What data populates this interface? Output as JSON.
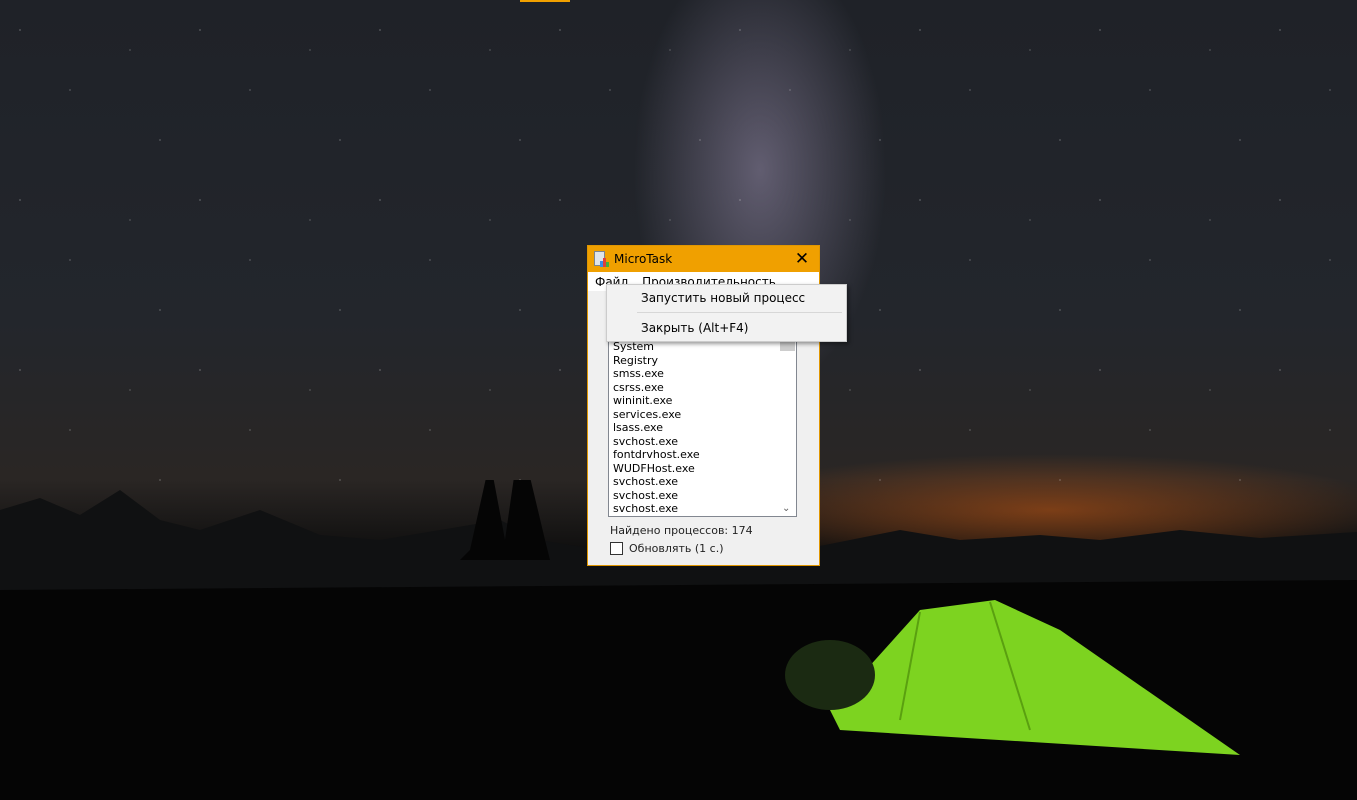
{
  "colors": {
    "accent": "#f0a000",
    "window_bg": "#f0f0f0"
  },
  "window": {
    "title": "MicroTask",
    "close_icon": "close-icon",
    "app_icon": "task-manager-icon"
  },
  "menu": {
    "file": "Файл",
    "performance": "Производительность"
  },
  "context_menu": {
    "items": [
      "Запустить новый процесс",
      "Закрыть (Alt+F4)"
    ]
  },
  "processes": [
    "System",
    "Registry",
    "smss.exe",
    "csrss.exe",
    "wininit.exe",
    "services.exe",
    "lsass.exe",
    "svchost.exe",
    "fontdrvhost.exe",
    "WUDFHost.exe",
    "svchost.exe",
    "svchost.exe",
    "svchost.exe"
  ],
  "status": {
    "found": "Найдено процессов: 174",
    "refresh_label": "Обновлять (1 с.)",
    "refresh_checked": false
  }
}
